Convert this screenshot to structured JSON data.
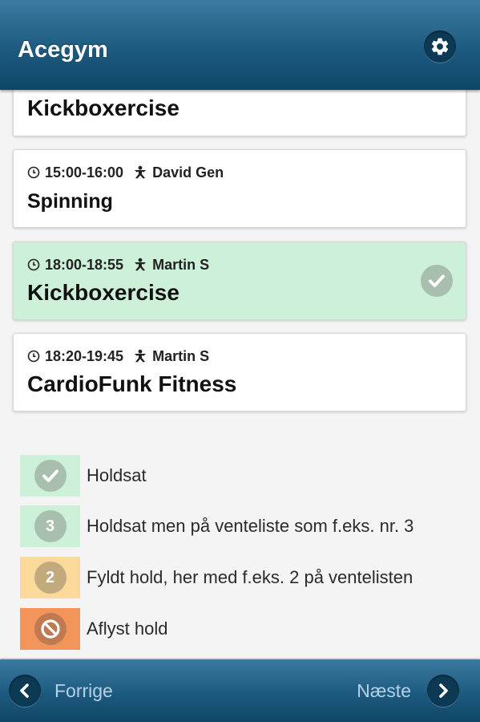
{
  "header": {
    "title": "Acegym",
    "settings_icon": "gear-icon"
  },
  "classes": [
    {
      "time": "",
      "instructor": "",
      "title": "Kickboxercise",
      "status": "none"
    },
    {
      "time": "15:00-16:00",
      "instructor": "David Gen",
      "title": "Spinning",
      "status": "none"
    },
    {
      "time": "18:00-18:55",
      "instructor": "Martin S",
      "title": "Kickboxercise",
      "status": "booked"
    },
    {
      "time": "18:20-19:45",
      "instructor": "Martin S",
      "title": "CardioFunk Fitness",
      "status": "none"
    }
  ],
  "legend": [
    {
      "symbol": "check",
      "label": "Holdsat",
      "bg": "#cdf1d8",
      "circle": "#a9bfae"
    },
    {
      "symbol": "3",
      "label": "Holdsat men på venteliste som f.eks. nr. 3",
      "bg": "#cdf1d8",
      "circle": "#a9bfae"
    },
    {
      "symbol": "2",
      "label": "Fyldt hold, her med f.eks. 2 på ventelisten",
      "bg": "#fbd99a",
      "circle": "#c3aa7d"
    },
    {
      "symbol": "ban",
      "label": "Aflyst hold",
      "bg": "#f2955a",
      "circle": "#c07a52"
    }
  ],
  "footer": {
    "prev_label": "Forrige",
    "next_label": "Næste"
  },
  "colors": {
    "header_blue": "#1d5a80",
    "booked_green": "#cdf1d8",
    "full_yellow": "#fbd99a",
    "cancelled_orange": "#f2955a"
  }
}
